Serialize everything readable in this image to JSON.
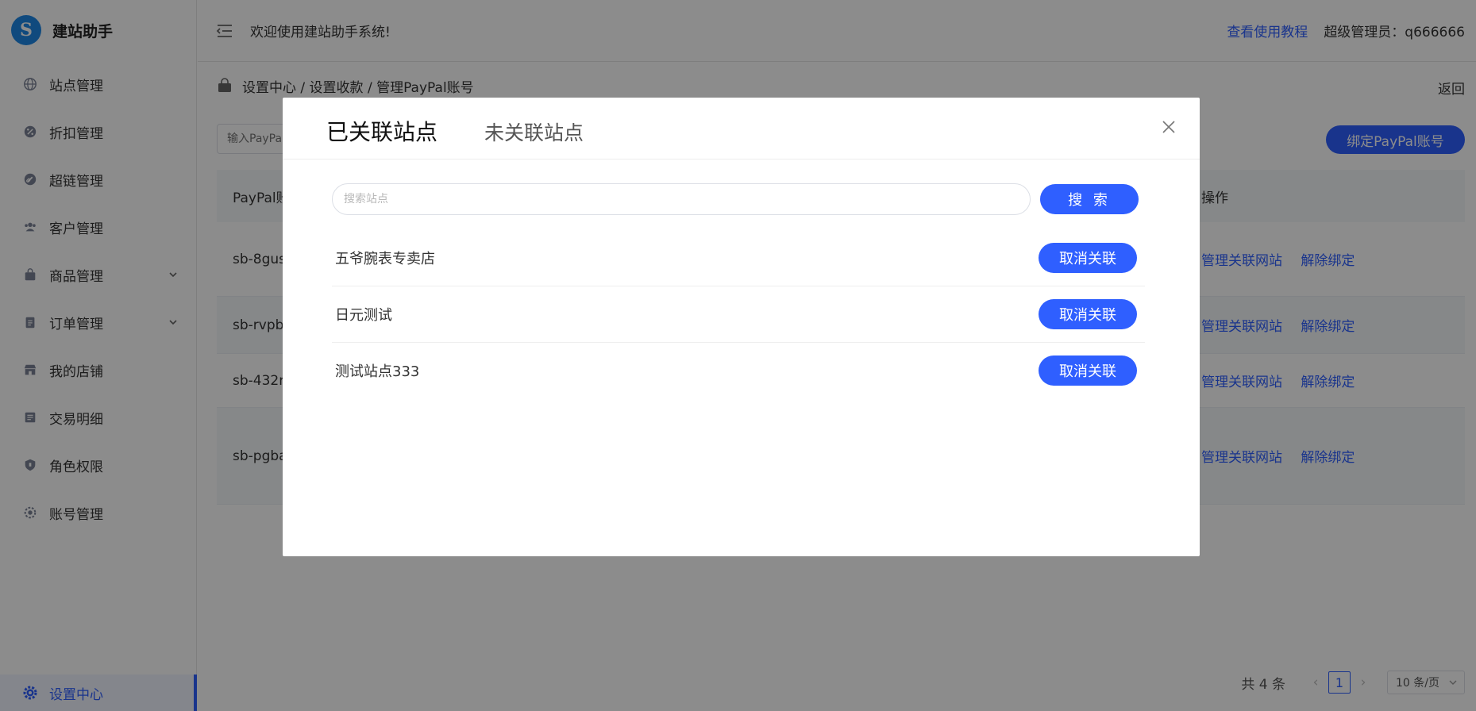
{
  "brand": {
    "logo_letter": "S",
    "title": "建站助手"
  },
  "sidebar": {
    "items": [
      {
        "label": "站点管理",
        "icon": "globe-icon"
      },
      {
        "label": "折扣管理",
        "icon": "discount-icon"
      },
      {
        "label": "超链管理",
        "icon": "link-icon"
      },
      {
        "label": "客户管理",
        "icon": "users-icon"
      },
      {
        "label": "商品管理",
        "icon": "bag-icon",
        "expandable": true
      },
      {
        "label": "订单管理",
        "icon": "clipboard-icon",
        "expandable": true
      },
      {
        "label": "我的店铺",
        "icon": "store-icon"
      },
      {
        "label": "交易明细",
        "icon": "receipt-icon"
      },
      {
        "label": "角色权限",
        "icon": "shield-icon"
      },
      {
        "label": "账号管理",
        "icon": "user-gear-icon"
      }
    ],
    "active_item": {
      "label": "设置中心",
      "icon": "gear-icon"
    }
  },
  "header": {
    "welcome": "欢迎使用建站助手系统!",
    "tutorial_link": "查看使用教程",
    "admin_info": "超级管理员：q666666"
  },
  "breadcrumb": {
    "path": "设置中心 / 设置收款 / 管理PayPal账号",
    "back": "返回"
  },
  "toolbar": {
    "search_placeholder": "输入PayPal",
    "bind_button": "绑定PayPal账号"
  },
  "table": {
    "header_first": "PayPal账",
    "header_op": "操作",
    "rows": [
      {
        "account": "sb-8gus",
        "op_manage": "管理关联网站",
        "op_unbind": "解除绑定"
      },
      {
        "account": "sb-rvpb",
        "op_manage": "管理关联网站",
        "op_unbind": "解除绑定"
      },
      {
        "account": "sb-432r",
        "op_manage": "管理关联网站",
        "op_unbind": "解除绑定"
      },
      {
        "account": "sb-pgba",
        "op_manage": "管理关联网站",
        "op_unbind": "解除绑定"
      }
    ]
  },
  "pagination": {
    "total": "共 4 条",
    "current_page": "1",
    "page_size": "10 条/页"
  },
  "modal": {
    "tab_linked": "已关联站点",
    "tab_unlinked": "未关联站点",
    "search_placeholder": "搜索站点",
    "search_button": "搜 索",
    "sites": [
      {
        "name": "五爷腕表专卖店",
        "action": "取消关联"
      },
      {
        "name": "日元测试",
        "action": "取消关联"
      },
      {
        "name": "测试站点333",
        "action": "取消关联"
      }
    ]
  },
  "colors": {
    "accent": "#2f5fff",
    "overlay": "rgba(0,0,0,0.45)"
  }
}
